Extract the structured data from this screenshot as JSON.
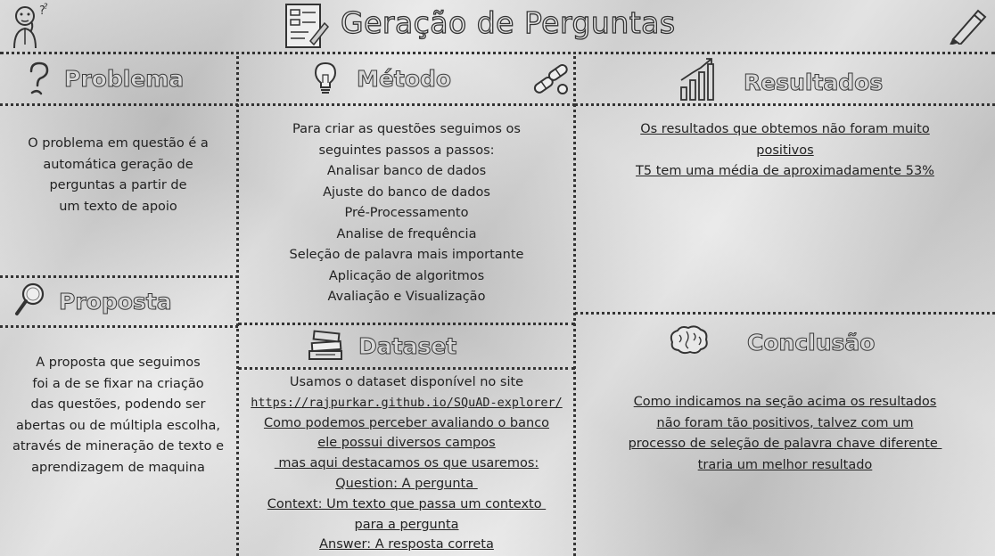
{
  "header": {
    "title": "Geração de Perguntas"
  },
  "sections": {
    "problema": {
      "title": "Problema",
      "lines": [
        "O problema em questão é a",
        "automática geração de",
        "perguntas a partir de",
        "um texto de apoio"
      ]
    },
    "metodo": {
      "title": "Método",
      "lines": [
        "Para criar as questões seguimos os",
        "seguintes passos a passos:",
        "Analisar banco de dados",
        "Ajuste do banco de dados",
        "Pré-Processamento",
        "Analise de frequência",
        "Seleção de palavra mais importante",
        "Aplicação de algoritmos",
        "Avaliação e Visualização"
      ]
    },
    "resultados": {
      "title": "Resultados",
      "lines": [
        "Os resultados que obtemos não foram muito",
        "positivos",
        "T5 tem uma média de aproximadamente 53%"
      ]
    },
    "proposta": {
      "title": "Proposta",
      "lines": [
        "A proposta que seguimos",
        "foi a de se fixar na criação",
        "das questões, podendo ser",
        "abertas ou de múltipla escolha,",
        "através de mineração de texto e",
        "aprendizagem de maquina"
      ]
    },
    "dataset": {
      "title": "Dataset",
      "lines": [
        "Usamos o dataset disponível no site",
        "https://rajpurkar.github.io/SQuAD-explorer/",
        "Como podemos perceber avaliando o banco",
        "ele possui diversos campos",
        " mas aqui destacamos os que usaremos:",
        "Question: A pergunta ",
        "Context: Um texto que passa um contexto ",
        "para a pergunta",
        "Answer: A resposta correta"
      ]
    },
    "conclusao": {
      "title": "Conclusão",
      "lines": [
        "Como indicamos na seção acima os resultados",
        "não foram tão positivos, talvez com um",
        "processo de seleção de palavra chave diferente ",
        "traria um melhor resultado"
      ]
    }
  },
  "icons": {
    "person": "thinking-person-icon",
    "form": "form-writing-icon",
    "pencil": "pencil-icon",
    "question": "question-mark-icon",
    "bulb": "lightbulb-icon",
    "pills": "pills-icon",
    "chart": "bar-chart-icon",
    "magnifier": "magnifier-icon",
    "books": "books-icon",
    "brain": "brain-icon"
  }
}
